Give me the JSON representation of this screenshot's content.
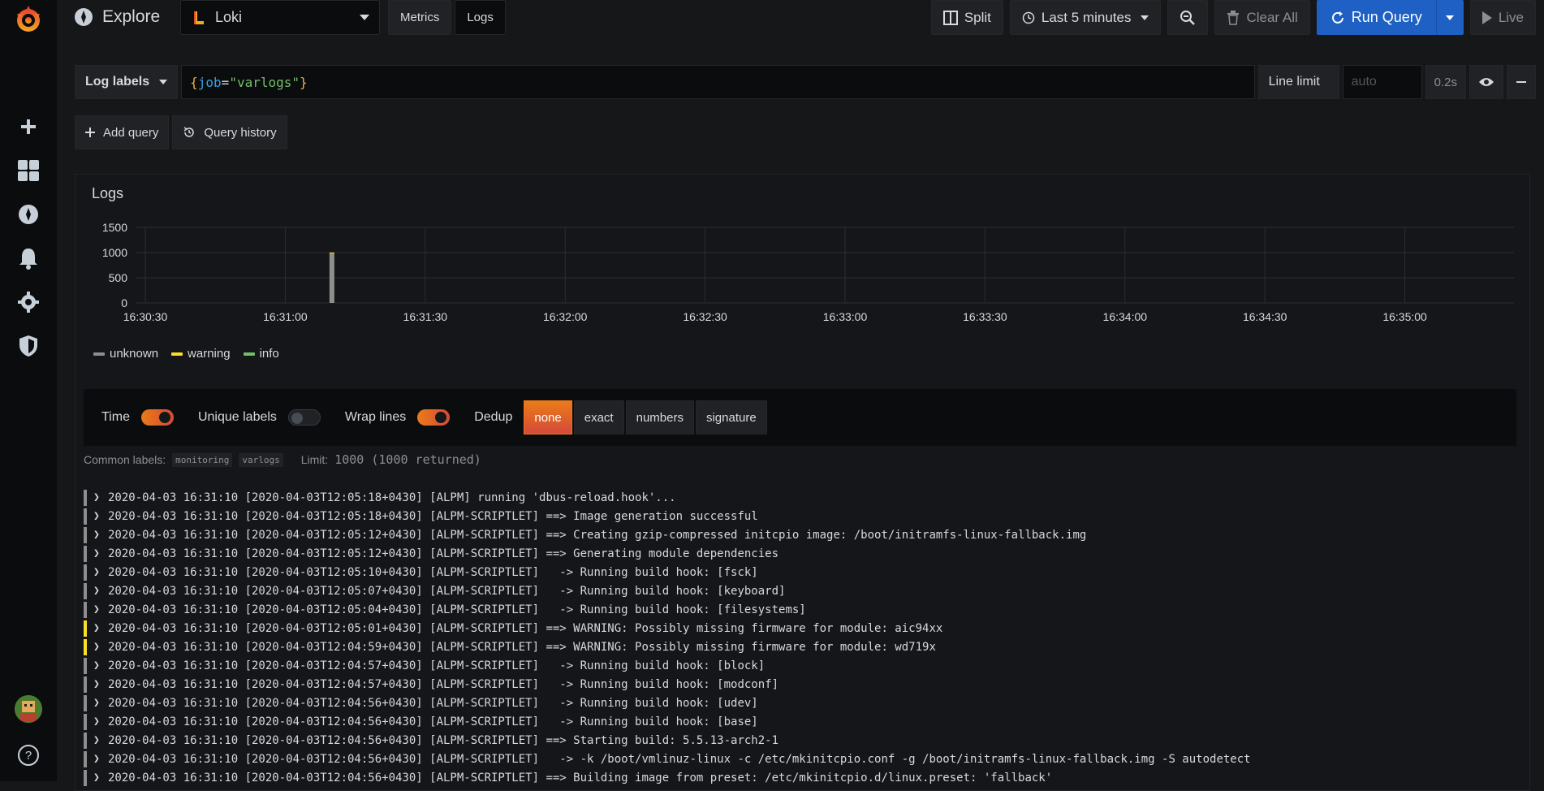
{
  "colors": {
    "accent_blue": "#1f60c4",
    "accent_orange": "#eb7b18",
    "unknown": "#8e8e8e",
    "warning": "#fade2a",
    "info": "#73bf69"
  },
  "header": {
    "title": "Explore",
    "datasource": "Loki",
    "tabs": [
      {
        "label": "Metrics"
      },
      {
        "label": "Logs"
      }
    ],
    "split_label": "Split",
    "time_range": "Last 5 minutes",
    "clear_label": "Clear All",
    "run_label": "Run Query",
    "live_label": "Live"
  },
  "query": {
    "labels_btn": "Log labels",
    "brace_open": "{",
    "key": "job",
    "eq": "=",
    "value": "\"varlogs\"",
    "brace_close": "}",
    "line_limit_label": "Line limit",
    "line_limit_placeholder": "auto",
    "duration": "0.2s"
  },
  "actions": {
    "add_query": "Add query",
    "query_history": "Query history"
  },
  "panel": {
    "title": "Logs"
  },
  "chart_data": {
    "type": "bar",
    "y_ticks": [
      "1500",
      "1000",
      "500",
      "0"
    ],
    "ylim": [
      0,
      1500
    ],
    "x_ticks": [
      "16:30:30",
      "16:31:00",
      "16:31:30",
      "16:32:00",
      "16:32:30",
      "16:33:00",
      "16:33:30",
      "16:34:00",
      "16:34:30",
      "16:35:00"
    ],
    "series": [
      {
        "name": "unknown",
        "x": "16:31:10",
        "value": 980
      },
      {
        "name": "warning",
        "x": "16:31:10",
        "value": 20
      },
      {
        "name": "info",
        "x": "16:31:10",
        "value": 0
      }
    ]
  },
  "options": {
    "time_label": "Time",
    "unique_labels_label": "Unique labels",
    "wrap_lines_label": "Wrap lines",
    "dedup_label": "Dedup",
    "dedup_options": [
      "none",
      "exact",
      "numbers",
      "signature"
    ]
  },
  "meta": {
    "common_labels_label": "Common labels:",
    "chips": [
      "monitoring",
      "varlogs"
    ],
    "limit_label": "Limit:",
    "limit_value": "1000 (1000 returned)"
  },
  "logs": [
    {
      "level": "unknown",
      "text": "2020-04-03 16:31:10 [2020-04-03T12:05:18+0430] [ALPM] running 'dbus-reload.hook'..."
    },
    {
      "level": "unknown",
      "text": "2020-04-03 16:31:10 [2020-04-03T12:05:18+0430] [ALPM-SCRIPTLET] ==> Image generation successful"
    },
    {
      "level": "unknown",
      "text": "2020-04-03 16:31:10 [2020-04-03T12:05:12+0430] [ALPM-SCRIPTLET] ==> Creating gzip-compressed initcpio image: /boot/initramfs-linux-fallback.img"
    },
    {
      "level": "unknown",
      "text": "2020-04-03 16:31:10 [2020-04-03T12:05:12+0430] [ALPM-SCRIPTLET] ==> Generating module dependencies"
    },
    {
      "level": "unknown",
      "text": "2020-04-03 16:31:10 [2020-04-03T12:05:10+0430] [ALPM-SCRIPTLET]   -> Running build hook: [fsck]"
    },
    {
      "level": "unknown",
      "text": "2020-04-03 16:31:10 [2020-04-03T12:05:07+0430] [ALPM-SCRIPTLET]   -> Running build hook: [keyboard]"
    },
    {
      "level": "unknown",
      "text": "2020-04-03 16:31:10 [2020-04-03T12:05:04+0430] [ALPM-SCRIPTLET]   -> Running build hook: [filesystems]"
    },
    {
      "level": "warning",
      "text": "2020-04-03 16:31:10 [2020-04-03T12:05:01+0430] [ALPM-SCRIPTLET] ==> WARNING: Possibly missing firmware for module: aic94xx"
    },
    {
      "level": "warning",
      "text": "2020-04-03 16:31:10 [2020-04-03T12:04:59+0430] [ALPM-SCRIPTLET] ==> WARNING: Possibly missing firmware for module: wd719x"
    },
    {
      "level": "unknown",
      "text": "2020-04-03 16:31:10 [2020-04-03T12:04:57+0430] [ALPM-SCRIPTLET]   -> Running build hook: [block]"
    },
    {
      "level": "unknown",
      "text": "2020-04-03 16:31:10 [2020-04-03T12:04:57+0430] [ALPM-SCRIPTLET]   -> Running build hook: [modconf]"
    },
    {
      "level": "unknown",
      "text": "2020-04-03 16:31:10 [2020-04-03T12:04:56+0430] [ALPM-SCRIPTLET]   -> Running build hook: [udev]"
    },
    {
      "level": "unknown",
      "text": "2020-04-03 16:31:10 [2020-04-03T12:04:56+0430] [ALPM-SCRIPTLET]   -> Running build hook: [base]"
    },
    {
      "level": "unknown",
      "text": "2020-04-03 16:31:10 [2020-04-03T12:04:56+0430] [ALPM-SCRIPTLET] ==> Starting build: 5.5.13-arch2-1"
    },
    {
      "level": "unknown",
      "text": "2020-04-03 16:31:10 [2020-04-03T12:04:56+0430] [ALPM-SCRIPTLET]   -> -k /boot/vmlinuz-linux -c /etc/mkinitcpio.conf -g /boot/initramfs-linux-fallback.img -S autodetect"
    },
    {
      "level": "unknown",
      "text": "2020-04-03 16:31:10 [2020-04-03T12:04:56+0430] [ALPM-SCRIPTLET] ==> Building image from preset: /etc/mkinitcpio.d/linux.preset: 'fallback'"
    }
  ]
}
